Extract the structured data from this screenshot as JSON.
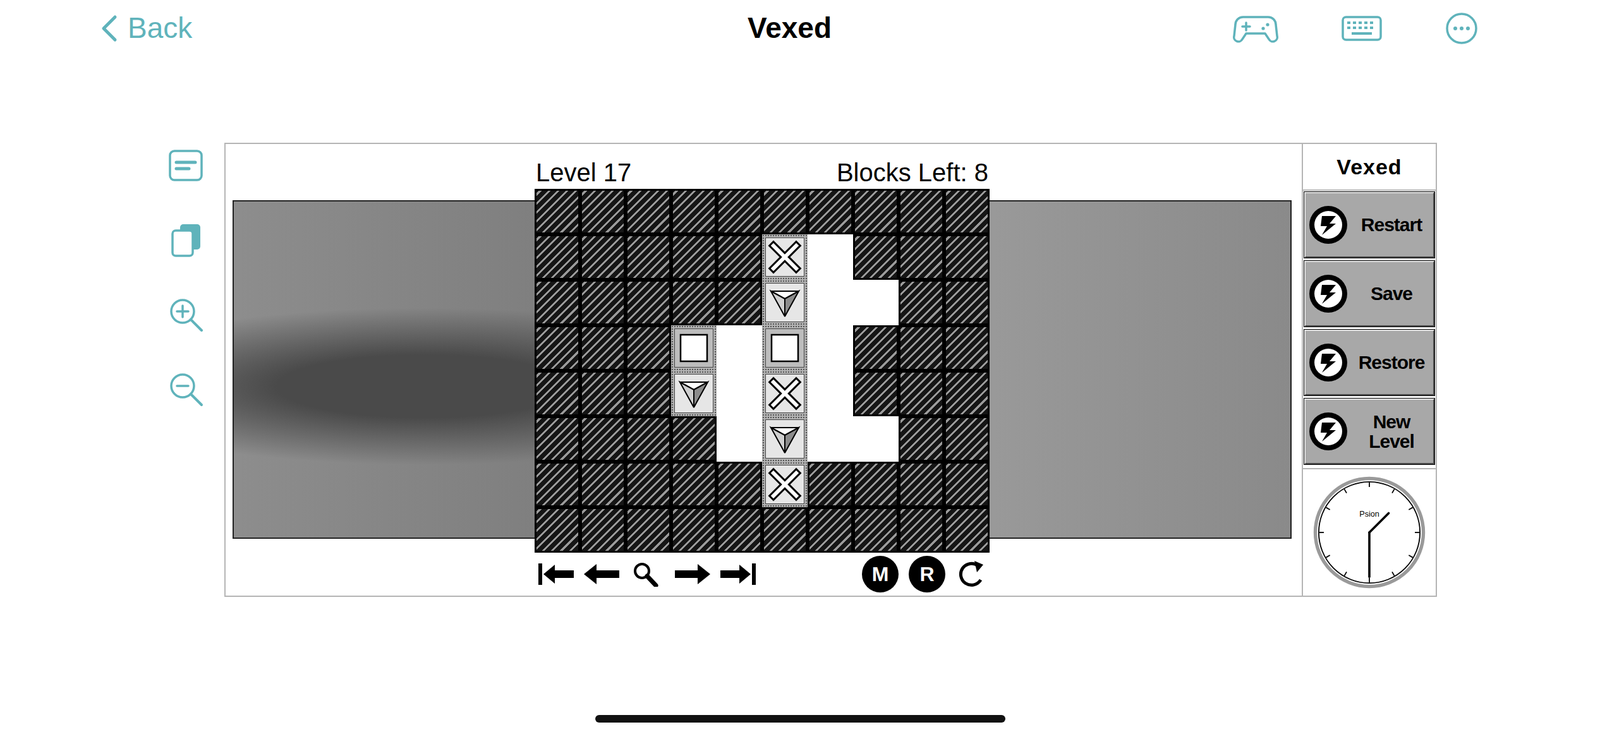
{
  "topbar": {
    "back": "Back",
    "title": "Vexed"
  },
  "game": {
    "level": "Level 17",
    "blocks_left": "Blocks Left: 8",
    "board": {
      "rows": [
        [
          "wall",
          "wall",
          "wall",
          "wall",
          "wall",
          "wall",
          "wall",
          "wall",
          "wall",
          "wall"
        ],
        [
          "wall",
          "wall",
          "wall",
          "wall",
          "wall",
          "cross",
          "empty",
          "wall",
          "wall",
          "wall"
        ],
        [
          "wall",
          "wall",
          "wall",
          "wall",
          "wall",
          "triangle",
          "empty",
          "empty",
          "wall",
          "wall"
        ],
        [
          "wall",
          "wall",
          "wall",
          "square",
          "empty",
          "square",
          "empty",
          "wall",
          "wall",
          "wall"
        ],
        [
          "wall",
          "wall",
          "wall",
          "triangle",
          "empty",
          "cross",
          "empty",
          "wall",
          "wall",
          "wall"
        ],
        [
          "wall",
          "wall",
          "wall",
          "wall",
          "empty",
          "triangle",
          "empty",
          "empty",
          "wall",
          "wall"
        ],
        [
          "wall",
          "wall",
          "wall",
          "wall",
          "wall",
          "cross",
          "wall",
          "wall",
          "wall",
          "wall"
        ],
        [
          "wall",
          "wall",
          "wall",
          "wall",
          "wall",
          "wall",
          "wall",
          "wall",
          "wall",
          "wall"
        ]
      ]
    },
    "controls": {
      "keys": [
        "M",
        "R"
      ]
    }
  },
  "panel": {
    "title": "Vexed",
    "buttons": [
      "Restart",
      "Save",
      "Restore",
      "New Level"
    ],
    "clock": {
      "label": "Psion",
      "hours": 1,
      "minutes": 30
    }
  }
}
